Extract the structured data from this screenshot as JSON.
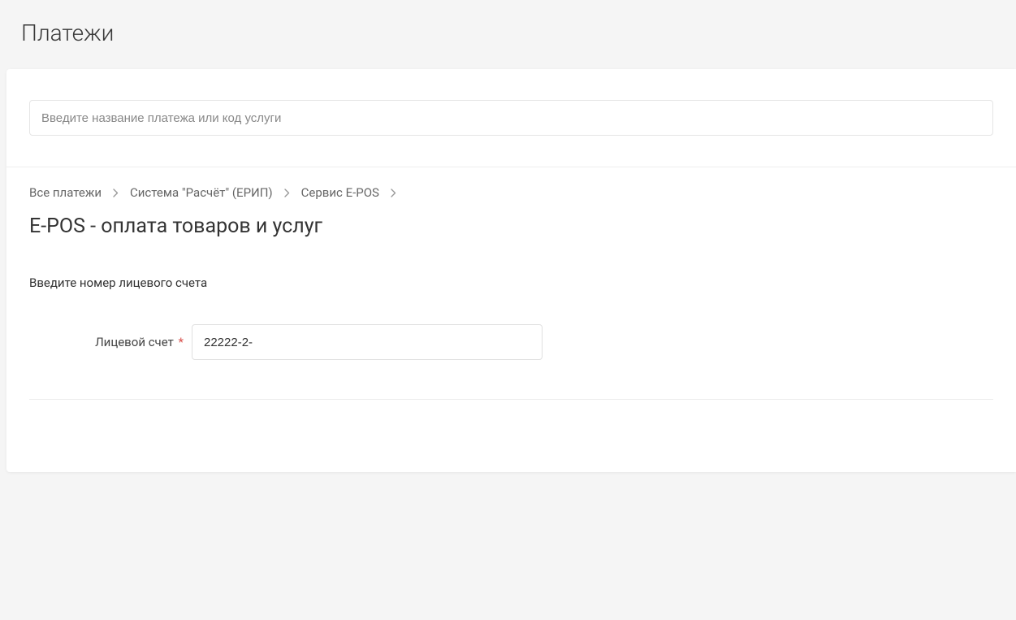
{
  "header": {
    "title": "Платежи"
  },
  "search": {
    "placeholder": "Введите название платежа или код услуги"
  },
  "breadcrumb": {
    "items": [
      {
        "label": "Все платежи"
      },
      {
        "label": "Система \"Расчёт\" (ЕРИП)"
      },
      {
        "label": "Сервис E-POS"
      }
    ]
  },
  "service": {
    "title": "E-POS - оплата товаров и услуг"
  },
  "form": {
    "instruction": "Введите номер лицевого счета",
    "account": {
      "label": "Лицевой счет",
      "required_marker": "*",
      "value": "22222-2-"
    }
  }
}
